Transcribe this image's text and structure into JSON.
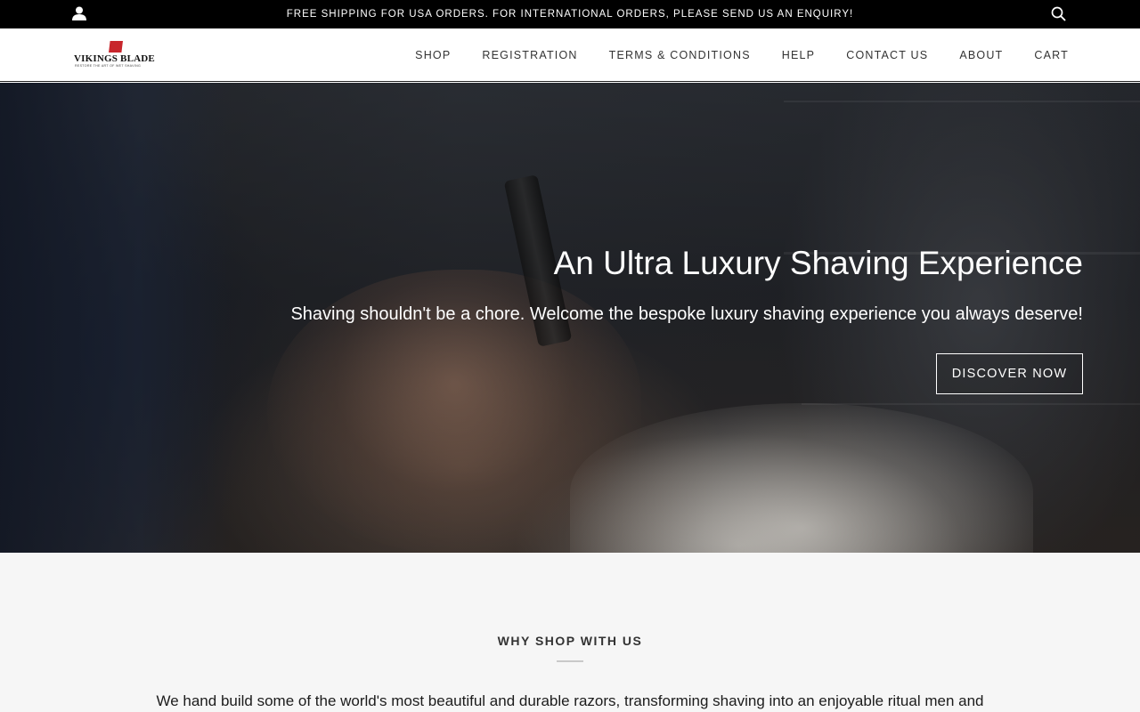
{
  "announcement": {
    "message": "FREE SHIPPING FOR USA ORDERS. FOR INTERNATIONAL ORDERS, PLEASE SEND US AN ENQUIRY!"
  },
  "header": {
    "logo": {
      "name": "VIKINGS BLADE",
      "tagline": "RESTORE THE ART OF WET SHAVING",
      "brand_color": "#c8262c"
    },
    "nav": [
      {
        "label": "SHOP"
      },
      {
        "label": "REGISTRATION"
      },
      {
        "label": "TERMS & CONDITIONS"
      },
      {
        "label": "HELP"
      },
      {
        "label": "CONTACT US"
      },
      {
        "label": "ABOUT"
      },
      {
        "label": "CART"
      }
    ]
  },
  "hero": {
    "title": "An Ultra Luxury Shaving Experience",
    "subtitle": "Shaving shouldn't be a chore. Welcome the bespoke luxury shaving experience you always deserve!",
    "cta_label": "DISCOVER NOW"
  },
  "why": {
    "title": "WHY SHOP WITH US",
    "text": "We hand build some of the world's most beautiful and durable razors, transforming shaving into an enjoyable ritual men and"
  },
  "icons": {
    "account": "account-icon",
    "search": "search-icon"
  }
}
